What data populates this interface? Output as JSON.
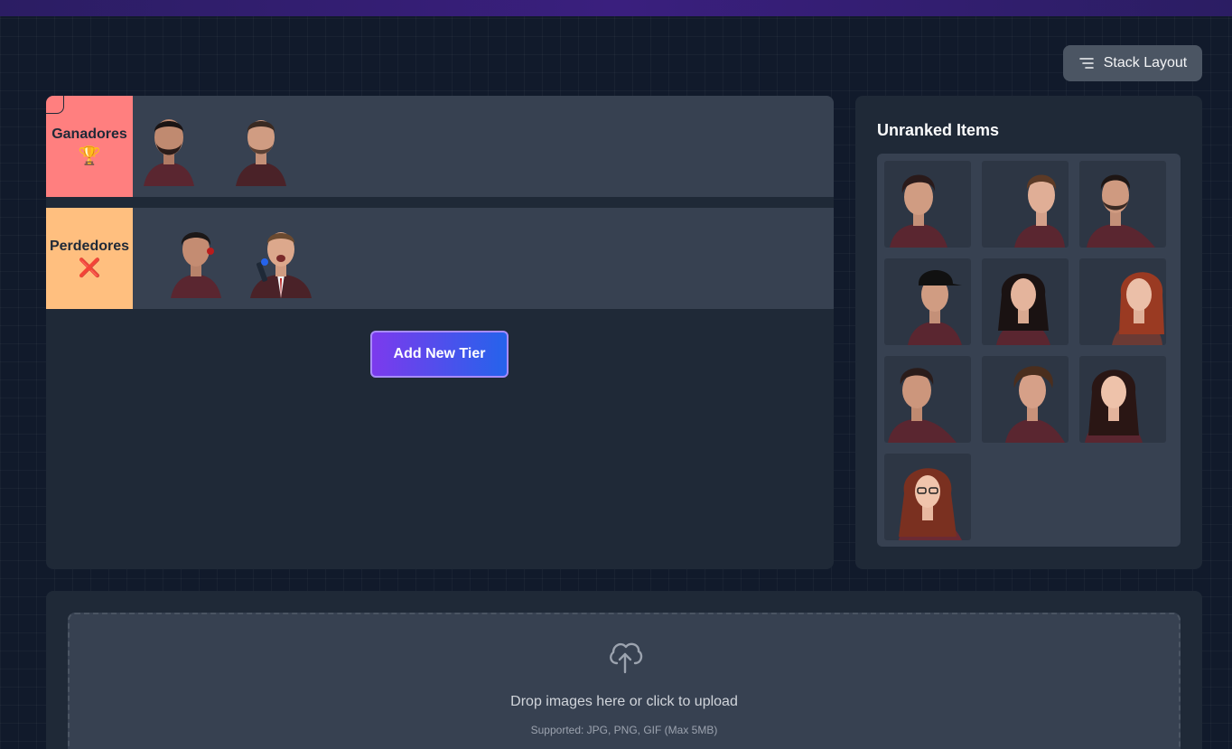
{
  "header": {
    "layout_button_label": "Stack Layout",
    "layout_icon": "lines-icon"
  },
  "tiers": [
    {
      "label": "Ganadores",
      "emoji": "🏆",
      "color": "#ff7f7f"
    },
    {
      "label": "Perdedores",
      "emoji": "❌",
      "color": "#ffbf7f"
    }
  ],
  "board": {
    "add_tier_label": "Add New Tier"
  },
  "unranked": {
    "title": "Unranked Items"
  },
  "upload": {
    "icon": "cloud-upload-icon",
    "title": "Drop images here or click to upload",
    "subtitle": "Supported: JPG, PNG, GIF (Max 5MB)"
  }
}
